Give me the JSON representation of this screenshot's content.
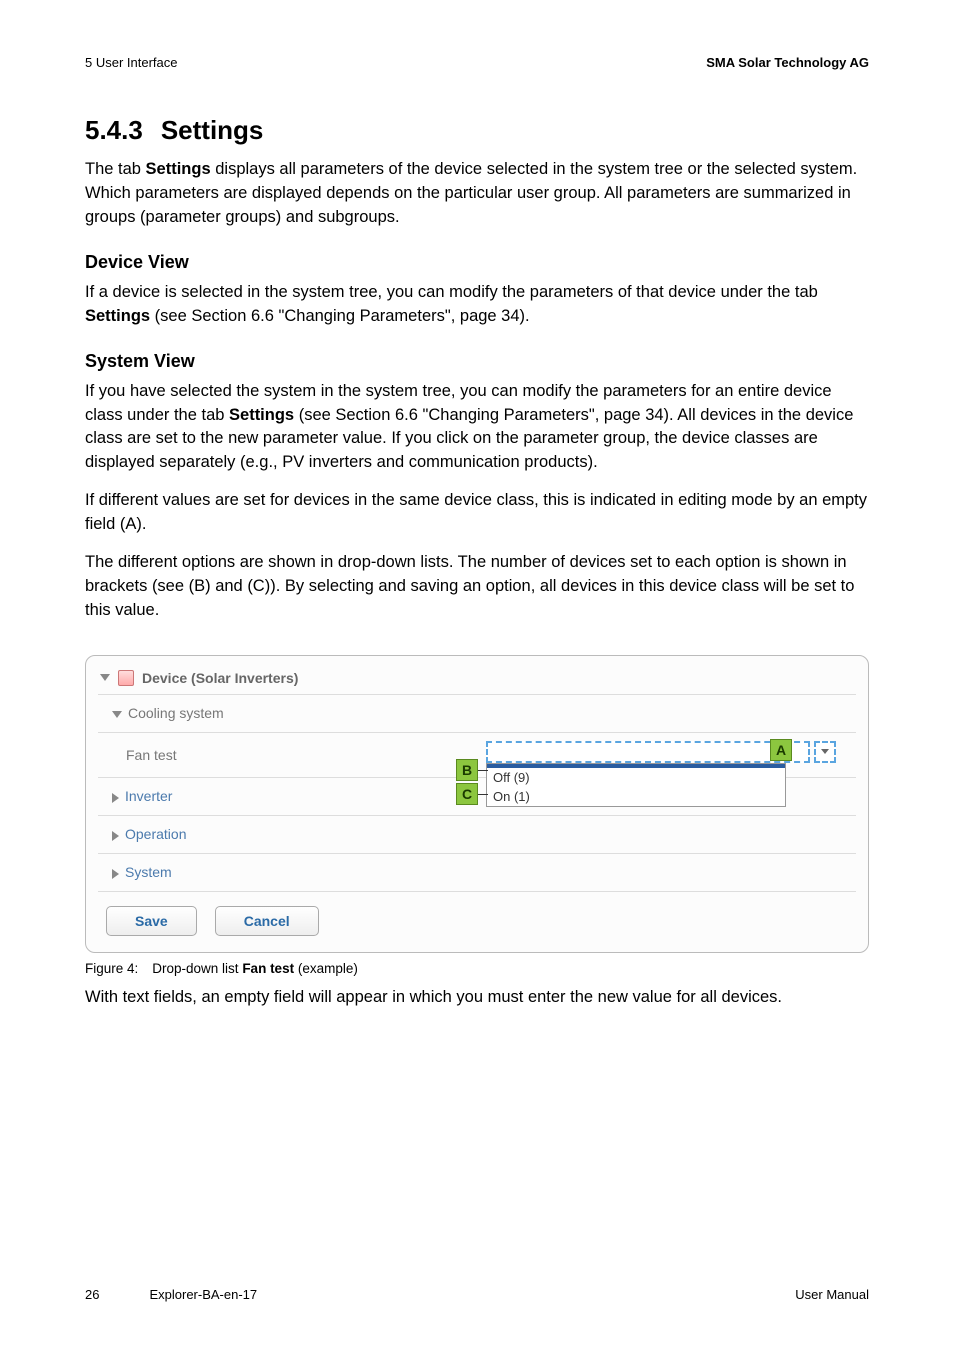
{
  "header": {
    "left": "5  User Interface",
    "right": "SMA Solar Technology AG"
  },
  "title": {
    "num": "5.4.3",
    "text": "Settings"
  },
  "intro": {
    "pre": "The tab ",
    "bold": "Settings",
    "post": " displays all parameters of the device selected in the system tree or the selected system. Which parameters are displayed depends on the particular user group. All parameters are summarized in groups (parameter groups) and subgroups."
  },
  "device_view": {
    "heading": "Device View",
    "pre": "If a device is selected in the system tree, you can modify the parameters of that device under the tab ",
    "bold": "Settings",
    "post": " (see Section 6.6 \"Changing Parameters\", page 34)."
  },
  "system_view": {
    "heading": "System View",
    "p1_pre": "If you have selected the system in the system tree, you can modify the parameters for an entire device class under the tab ",
    "p1_bold": "Settings",
    "p1_post": " (see Section 6.6 \"Changing Parameters\", page 34). All devices in the device class are set to the new parameter value. If you click on the parameter group, the device classes are displayed separately (e.g., PV inverters and communication products).",
    "p2": "If different values are set for devices in the same device class, this is indicated in editing mode by an empty field (A).",
    "p3": "The different options are shown in drop-down lists. The number of devices set to each option is shown in brackets (see (B) and (C)). By selecting and saving an option, all devices in this device class will be set to this value."
  },
  "ui": {
    "device_label": "Device  (Solar Inverters)",
    "rows": {
      "cooling": "Cooling system",
      "fan_test": "Fan test",
      "inverter": "Inverter",
      "operation": "Operation",
      "system": "System"
    },
    "dropdown": {
      "opt_off": "Off (9)",
      "opt_on": "On (1)"
    },
    "callouts": {
      "a": "A",
      "b": "B",
      "c": "C"
    },
    "buttons": {
      "save": "Save",
      "cancel": "Cancel"
    }
  },
  "figure": {
    "label": "Figure 4:",
    "pre": "Drop-down list ",
    "bold": "Fan test",
    "post": " (example)"
  },
  "closing": "With text fields, an empty field will appear in which you must enter the new value for all devices.",
  "footer": {
    "page": "26",
    "doc": "Explorer-BA-en-17",
    "right": "User Manual"
  }
}
